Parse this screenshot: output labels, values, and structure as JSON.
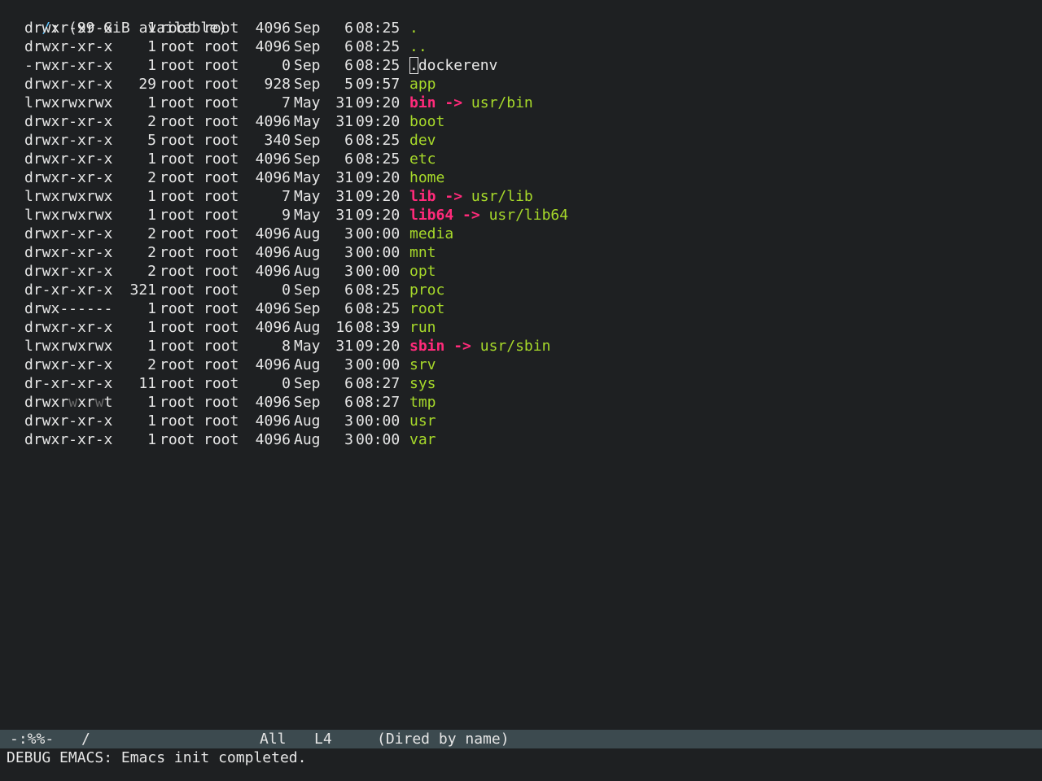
{
  "header": {
    "dir": "/",
    "rest": ": (99 GiB available)"
  },
  "entries": [
    {
      "perms": "drwxr-xr-x",
      "links": "1",
      "owner": "root",
      "group": "root",
      "size": "4096",
      "month": "Sep",
      "day": "6",
      "time": "08:25",
      "name": ".",
      "kind": "dir"
    },
    {
      "perms": "drwxr-xr-x",
      "links": "1",
      "owner": "root",
      "group": "root",
      "size": "4096",
      "month": "Sep",
      "day": "6",
      "time": "08:25",
      "name": "..",
      "kind": "dir"
    },
    {
      "perms": "-rwxr-xr-x",
      "links": "1",
      "owner": "root",
      "group": "root",
      "size": "0",
      "month": "Sep",
      "day": "6",
      "time": "08:25",
      "name": ".dockerenv",
      "kind": "file"
    },
    {
      "perms": "drwxr-xr-x",
      "links": "29",
      "owner": "root",
      "group": "root",
      "size": "928",
      "month": "Sep",
      "day": "5",
      "time": "09:57",
      "name": "app",
      "kind": "dir"
    },
    {
      "perms": "lrwxrwxrwx",
      "links": "1",
      "owner": "root",
      "group": "root",
      "size": "7",
      "month": "May",
      "day": "31",
      "time": "09:20",
      "name": "bin",
      "kind": "link",
      "target": "usr/bin"
    },
    {
      "perms": "drwxr-xr-x",
      "links": "2",
      "owner": "root",
      "group": "root",
      "size": "4096",
      "month": "May",
      "day": "31",
      "time": "09:20",
      "name": "boot",
      "kind": "dir"
    },
    {
      "perms": "drwxr-xr-x",
      "links": "5",
      "owner": "root",
      "group": "root",
      "size": "340",
      "month": "Sep",
      "day": "6",
      "time": "08:25",
      "name": "dev",
      "kind": "dir"
    },
    {
      "perms": "drwxr-xr-x",
      "links": "1",
      "owner": "root",
      "group": "root",
      "size": "4096",
      "month": "Sep",
      "day": "6",
      "time": "08:25",
      "name": "etc",
      "kind": "dir"
    },
    {
      "perms": "drwxr-xr-x",
      "links": "2",
      "owner": "root",
      "group": "root",
      "size": "4096",
      "month": "May",
      "day": "31",
      "time": "09:20",
      "name": "home",
      "kind": "dir"
    },
    {
      "perms": "lrwxrwxrwx",
      "links": "1",
      "owner": "root",
      "group": "root",
      "size": "7",
      "month": "May",
      "day": "31",
      "time": "09:20",
      "name": "lib",
      "kind": "link",
      "target": "usr/lib"
    },
    {
      "perms": "lrwxrwxrwx",
      "links": "1",
      "owner": "root",
      "group": "root",
      "size": "9",
      "month": "May",
      "day": "31",
      "time": "09:20",
      "name": "lib64",
      "kind": "link",
      "target": "usr/lib64"
    },
    {
      "perms": "drwxr-xr-x",
      "links": "2",
      "owner": "root",
      "group": "root",
      "size": "4096",
      "month": "Aug",
      "day": "3",
      "time": "00:00",
      "name": "media",
      "kind": "dir"
    },
    {
      "perms": "drwxr-xr-x",
      "links": "2",
      "owner": "root",
      "group": "root",
      "size": "4096",
      "month": "Aug",
      "day": "3",
      "time": "00:00",
      "name": "mnt",
      "kind": "dir"
    },
    {
      "perms": "drwxr-xr-x",
      "links": "2",
      "owner": "root",
      "group": "root",
      "size": "4096",
      "month": "Aug",
      "day": "3",
      "time": "00:00",
      "name": "opt",
      "kind": "dir"
    },
    {
      "perms": "dr-xr-xr-x",
      "links": "321",
      "owner": "root",
      "group": "root",
      "size": "0",
      "month": "Sep",
      "day": "6",
      "time": "08:25",
      "name": "proc",
      "kind": "dir"
    },
    {
      "perms": "drwx------",
      "links": "1",
      "owner": "root",
      "group": "root",
      "size": "4096",
      "month": "Sep",
      "day": "6",
      "time": "08:25",
      "name": "root",
      "kind": "dir"
    },
    {
      "perms": "drwxr-xr-x",
      "links": "1",
      "owner": "root",
      "group": "root",
      "size": "4096",
      "month": "Aug",
      "day": "16",
      "time": "08:39",
      "name": "run",
      "kind": "dir"
    },
    {
      "perms": "lrwxrwxrwx",
      "links": "1",
      "owner": "root",
      "group": "root",
      "size": "8",
      "month": "May",
      "day": "31",
      "time": "09:20",
      "name": "sbin",
      "kind": "link",
      "target": "usr/sbin"
    },
    {
      "perms": "drwxr-xr-x",
      "links": "2",
      "owner": "root",
      "group": "root",
      "size": "4096",
      "month": "Aug",
      "day": "3",
      "time": "00:00",
      "name": "srv",
      "kind": "dir"
    },
    {
      "perms": "dr-xr-xr-x",
      "links": "11",
      "owner": "root",
      "group": "root",
      "size": "0",
      "month": "Sep",
      "day": "6",
      "time": "08:27",
      "name": "sys",
      "kind": "dir"
    },
    {
      "perms": "drwxrwxrwt",
      "links": "1",
      "owner": "root",
      "group": "root",
      "size": "4096",
      "month": "Sep",
      "day": "6",
      "time": "08:27",
      "name": "tmp",
      "kind": "dir"
    },
    {
      "perms": "drwxr-xr-x",
      "links": "1",
      "owner": "root",
      "group": "root",
      "size": "4096",
      "month": "Aug",
      "day": "3",
      "time": "00:00",
      "name": "usr",
      "kind": "dir"
    },
    {
      "perms": "drwxr-xr-x",
      "links": "1",
      "owner": "root",
      "group": "root",
      "size": "4096",
      "month": "Aug",
      "day": "3",
      "time": "00:00",
      "name": "var",
      "kind": "dir"
    }
  ],
  "link_arrow": "->",
  "modeline": {
    "status": "-:%%-",
    "buffer_name": "/",
    "position": "All",
    "line": "L4",
    "mode": "(Dired by name)"
  },
  "echo_area": {
    "message": "DEBUG EMACS: Emacs init completed."
  },
  "colors": {
    "background": "#1e2022",
    "foreground": "#e6e6e6",
    "directory": "#a6d82a",
    "symlink": "#ff2a7a",
    "header_dir": "#5ec4ff",
    "modeline_bg": "#3c4a4f"
  }
}
